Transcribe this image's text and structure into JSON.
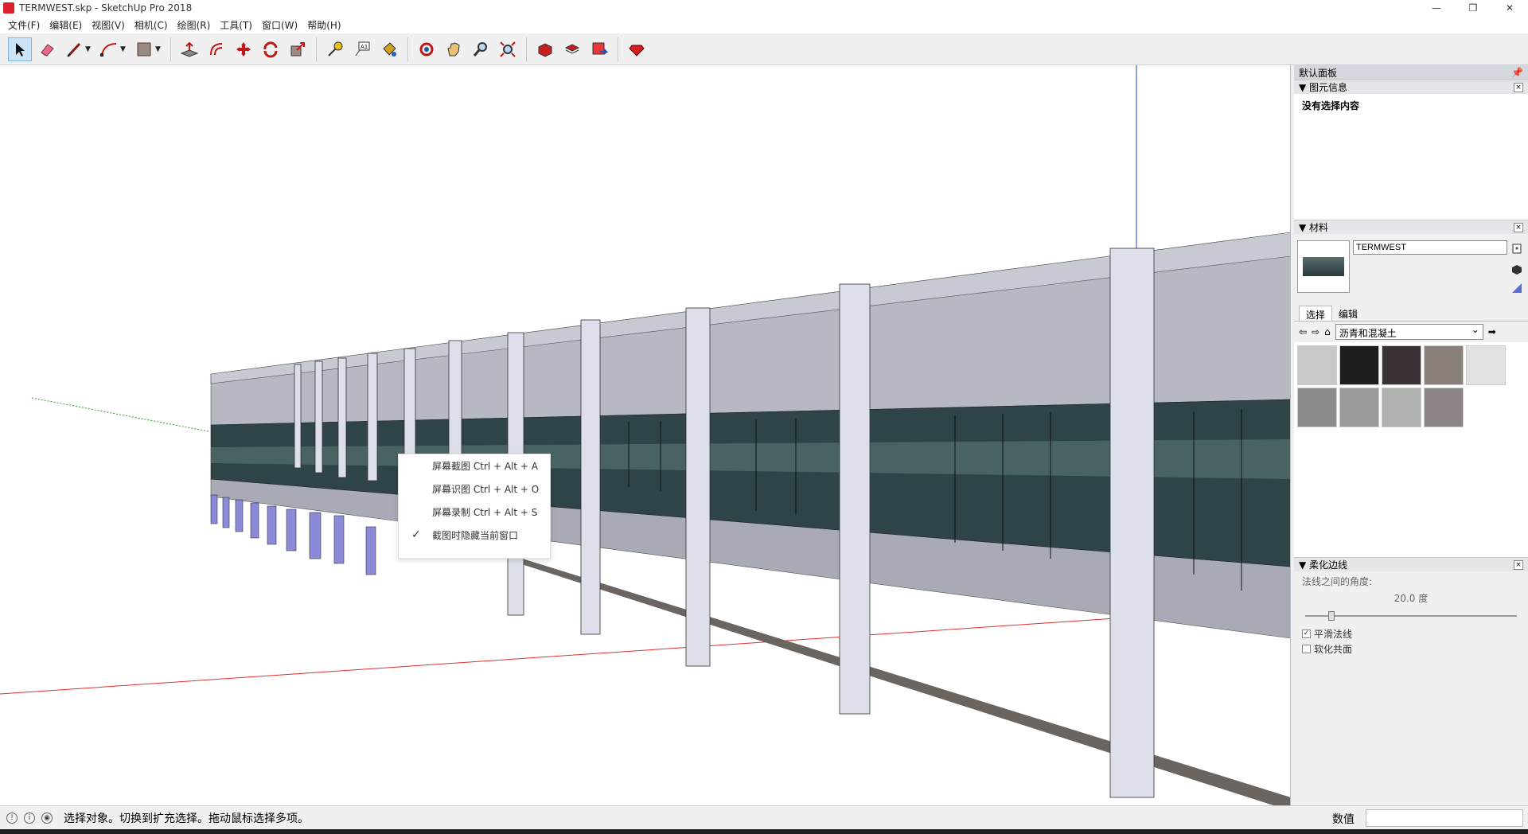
{
  "window": {
    "title": "TERMWEST.skp - SketchUp Pro 2018",
    "controls": [
      "—",
      "❐",
      "✕"
    ]
  },
  "menu": [
    "文件(F)",
    "编辑(E)",
    "视图(V)",
    "相机(C)",
    "绘图(R)",
    "工具(T)",
    "窗口(W)",
    "帮助(H)"
  ],
  "toolbar": {
    "tools": [
      "select-tool-icon",
      "eraser-tool-icon",
      "line-tool-icon",
      "arc-tool-icon",
      "rectangle-tool-icon",
      "push-pull-tool-icon",
      "offset-tool-icon",
      "move-tool-icon",
      "rotate-tool-icon",
      "scale-tool-icon",
      "tape-measure-icon",
      "text-tool-icon",
      "paint-bucket-icon",
      "orbit-icon",
      "pan-icon",
      "zoom-icon",
      "zoom-extents-icon",
      "3d-warehouse-icon",
      "extension-warehouse-icon",
      "layout-icon",
      "ruby-icon"
    ]
  },
  "context_menu": {
    "items": [
      {
        "label": "屏幕截图 Ctrl + Alt + A",
        "checked": false
      },
      {
        "label": "屏幕识图 Ctrl + Alt + O",
        "checked": false
      },
      {
        "label": "屏幕录制 Ctrl + Alt + S",
        "checked": false
      },
      {
        "label": "截图时隐藏当前窗口",
        "checked": true
      }
    ]
  },
  "tray": {
    "title": "默认面板",
    "entity_info": {
      "header": "图元信息",
      "empty_text": "没有选择内容"
    },
    "materials": {
      "header": "材料",
      "name_value": "TERMWEST",
      "tab_select": "选择",
      "tab_edit": "编辑",
      "library": "沥青和混凝土",
      "swatch_colors": [
        "#c9c9c9",
        "#1e1e1e",
        "#3a3236",
        "#8a817c",
        "#e2e2e2",
        "#8c8c8c",
        "#9a9a9a",
        "#b0b2b0",
        "#8d8585"
      ]
    },
    "soften": {
      "header": "柔化边线",
      "angle_label": "法线之间的角度:",
      "angle_value": "20.0 度",
      "angle_fraction": 0.11,
      "smooth_label": "平滑法线",
      "smooth_checked": true,
      "coplanar_label": "软化共面",
      "coplanar_checked": false
    }
  },
  "status": {
    "message": "选择对象。切换到扩充选择。拖动鼠标选择多项。",
    "vcb_label": "数值",
    "vcb_value": ""
  },
  "colors": {
    "facade": "#a8aab5",
    "glass": "#2e4446",
    "column": "#dde0ea",
    "axis_red": "#e03030",
    "axis_green": "#2a9a2a",
    "axis_blue": "#2040c0"
  }
}
